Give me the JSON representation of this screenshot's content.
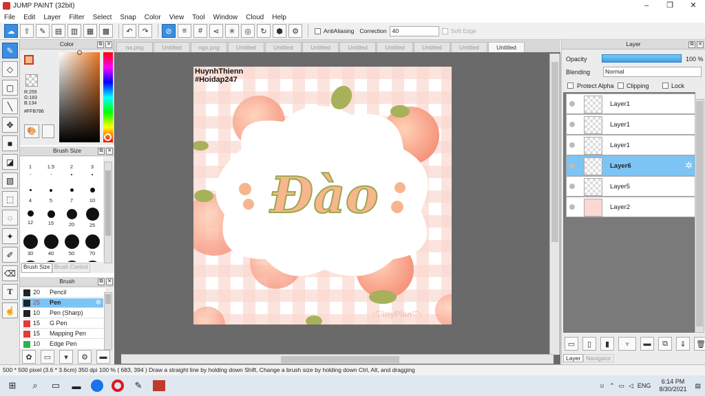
{
  "window": {
    "title": "JUMP PAINT (32bit)",
    "controls": [
      "–",
      "❐",
      "✕"
    ]
  },
  "menu": [
    "File",
    "Edit",
    "Layer",
    "Filter",
    "Select",
    "Snap",
    "Color",
    "View",
    "Tool",
    "Window",
    "Cloud",
    "Help"
  ],
  "toolbar": {
    "antialias_label": "AntiAliasing",
    "correction_label": "Correction",
    "correction_value": "40",
    "softedge_label": "Soft Edge"
  },
  "color_panel": {
    "title": "Color",
    "rgb": [
      "R:255",
      "G:183",
      "B:134"
    ],
    "hex": "#FFB786",
    "fg": "#ffb786",
    "bg": "#ffffff"
  },
  "brush_size_panel": {
    "title": "Brush Size",
    "sizes": [
      "1",
      "1.5",
      "2",
      "3",
      "4",
      "5",
      "7",
      "10",
      "12",
      "15",
      "20",
      "25",
      "30",
      "40",
      "50",
      "70"
    ],
    "tabs": [
      "Brush Size",
      "Brush Control"
    ]
  },
  "brush_panel": {
    "title": "Brush",
    "items": [
      {
        "size": "20",
        "name": "Pencil",
        "color": "#222222"
      },
      {
        "size": "25",
        "name": "Pen",
        "color": "#222222",
        "selected": true
      },
      {
        "size": "10",
        "name": "Pen (Sharp)",
        "color": "#222222"
      },
      {
        "size": "15",
        "name": "G Pen",
        "color": "#e53935"
      },
      {
        "size": "15",
        "name": "Mapping Pen",
        "color": "#e53935"
      },
      {
        "size": "10",
        "name": "Edge Pen",
        "color": "#2bb34a"
      }
    ]
  },
  "tabs": [
    "na.png",
    "Untitled",
    "ngo.png",
    "Untitled",
    "Untitled",
    "Untitled",
    "Untitled",
    "Untitled",
    "Untitled",
    "Untitled",
    "Untitled"
  ],
  "artwork": {
    "credit1": "HuynhThienn",
    "credit2": "#Hoidap247",
    "title": "Đào",
    "watermark": ":♡inyPlan♡:"
  },
  "layer_panel": {
    "title": "Layer",
    "opacity_label": "Opacity",
    "opacity_value": "100 %",
    "blending_label": "Blending",
    "blending_value": "Normal",
    "protect_alpha": "Protect Alpha",
    "clipping": "Clipping",
    "lock": "Lock",
    "layers": [
      "Layer1",
      "Layer1",
      "Layer1",
      "Layer6",
      "Layer5",
      "Layer2"
    ],
    "selected_index": 3,
    "bottom_tabs": [
      "Layer",
      "Navigator"
    ]
  },
  "status": "500 * 500 pixel  (3.6 * 3.6cm)  350 dpi  100 %  ( 683, 394 )  Draw a straight line by holding down Shift, Change a brush size by holding down Ctrl, Alt, and dragging",
  "taskbar": {
    "lang": "ENG",
    "time": "6:14 PM",
    "date": "8/30/2021"
  }
}
